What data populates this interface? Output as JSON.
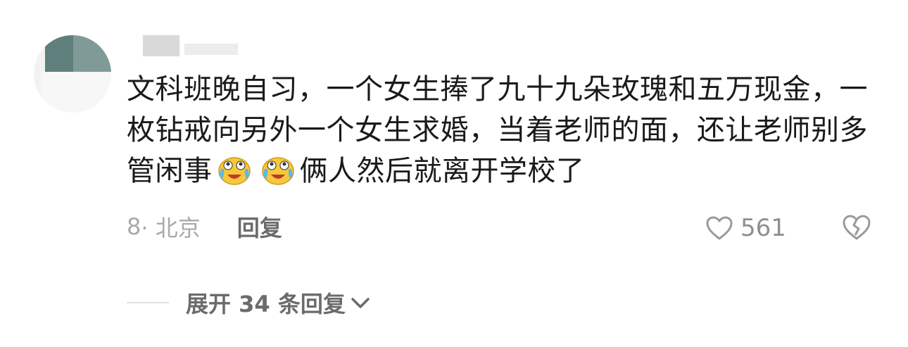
{
  "comment": {
    "text_part1": "文科班晚自习，一个女生捧了九十九朵玫瑰和五万现金，一枚钻戒向另外一个女生求婚，当着老师的面，还让老师别多管闲事",
    "text_part2": "俩人然后就离开学校了",
    "emoji_names": [
      "laughing-crying-emoji",
      "laughing-crying-emoji"
    ]
  },
  "meta": {
    "time": "8 ",
    "location": "· 北京",
    "reply_label": "回复"
  },
  "actions": {
    "like_count": "561"
  },
  "expand": {
    "label": "展开 34 条回复"
  },
  "colors": {
    "text": "#1a1a1a",
    "meta": "#a9a9a9",
    "reply": "#6b6b6b",
    "emoji_face": "#f7c83a",
    "emoji_tear": "#59b8f0"
  }
}
